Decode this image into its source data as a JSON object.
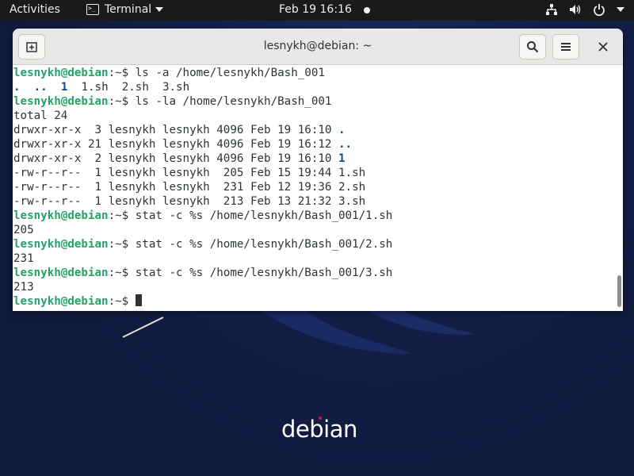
{
  "topbar": {
    "activities": "Activities",
    "app_name": "Terminal",
    "clock": "Feb 19  16:16"
  },
  "window": {
    "title": "lesnykh@debian: ~"
  },
  "wallpaper": {
    "brand": "debian",
    "accent": "#d70a53"
  },
  "terminal": {
    "prompt_user": "lesnykh@debian",
    "prompt_suffix": ":~$ ",
    "lines": [
      {
        "type": "cmd",
        "text": "ls -a /home/lesnykh/Bash_001"
      },
      {
        "type": "ls-a",
        "dot": ".",
        "dotdot": "..",
        "d1": "1",
        "rest": "  1.sh  2.sh  3.sh"
      },
      {
        "type": "cmd",
        "text": "ls -la /home/lesnykh/Bash_001"
      },
      {
        "type": "out",
        "text": "total 24"
      },
      {
        "type": "lsl",
        "meta": "drwxr-xr-x  3 lesnykh lesnykh 4096 Feb 19 16:10 ",
        "name": ".",
        "dir": true
      },
      {
        "type": "lsl",
        "meta": "drwxr-xr-x 21 lesnykh lesnykh 4096 Feb 19 16:12 ",
        "name": "..",
        "dir": true
      },
      {
        "type": "lsl",
        "meta": "drwxr-xr-x  2 lesnykh lesnykh 4096 Feb 19 16:10 ",
        "name": "1",
        "dir": true
      },
      {
        "type": "lsl",
        "meta": "-rw-r--r--  1 lesnykh lesnykh  205 Feb 15 19:44 ",
        "name": "1.sh",
        "dir": false
      },
      {
        "type": "lsl",
        "meta": "-rw-r--r--  1 lesnykh lesnykh  231 Feb 12 19:36 ",
        "name": "2.sh",
        "dir": false
      },
      {
        "type": "lsl",
        "meta": "-rw-r--r--  1 lesnykh lesnykh  213 Feb 13 21:32 ",
        "name": "3.sh",
        "dir": false
      },
      {
        "type": "cmd",
        "text": "stat -c %s /home/lesnykh/Bash_001/1.sh"
      },
      {
        "type": "out",
        "text": "205"
      },
      {
        "type": "cmd",
        "text": "stat -c %s /home/lesnykh/Bash_001/2.sh"
      },
      {
        "type": "out",
        "text": "231"
      },
      {
        "type": "cmd",
        "text": "stat -c %s /home/lesnykh/Bash_001/3.sh"
      },
      {
        "type": "out",
        "text": "213"
      },
      {
        "type": "prompt",
        "text": ""
      }
    ]
  }
}
